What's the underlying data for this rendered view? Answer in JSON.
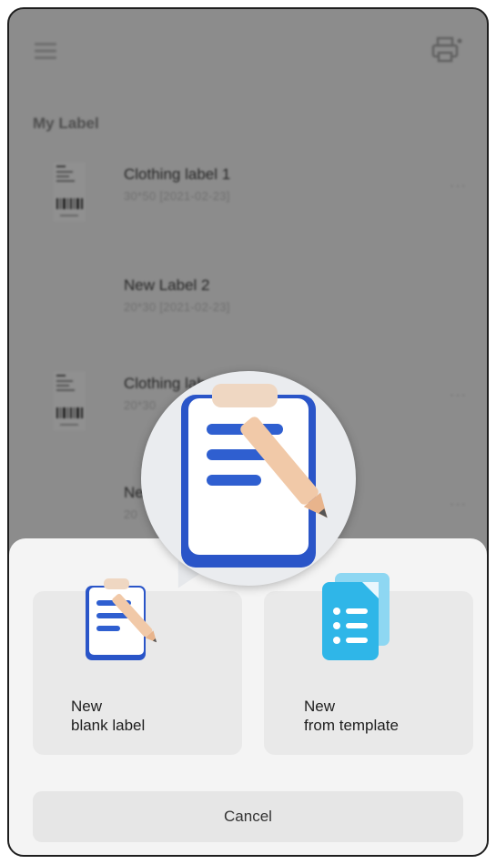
{
  "app": {
    "section_title": "My Label"
  },
  "labels": [
    {
      "name": "Clothing label 1",
      "meta": "30*50  [2021-02-23]",
      "thumb": "barcode-label-thumbnail"
    },
    {
      "name": "New Label 2",
      "meta": "20*30  [2021-02-23]",
      "thumb": ""
    },
    {
      "name": "Clothing label 1",
      "meta": "20*30",
      "thumb": "barcode-label-thumbnail"
    },
    {
      "name": "Ne",
      "meta": "20",
      "thumb": ""
    }
  ],
  "sheet": {
    "blank_label": "New\nblank label",
    "template_label": "New\nfrom template",
    "cancel": "Cancel"
  },
  "colors": {
    "overlay": "#8c8c8c",
    "sheet": "#f4f4f4",
    "card": "#e9e9e9",
    "clipboard_blue": "#2f5fd0",
    "template_blue": "#2fb6e8"
  },
  "icons": {
    "menu": "menu-icon",
    "printer": "printer-icon",
    "blank_label": "clipboard-pencil-icon",
    "template": "template-document-icon"
  }
}
